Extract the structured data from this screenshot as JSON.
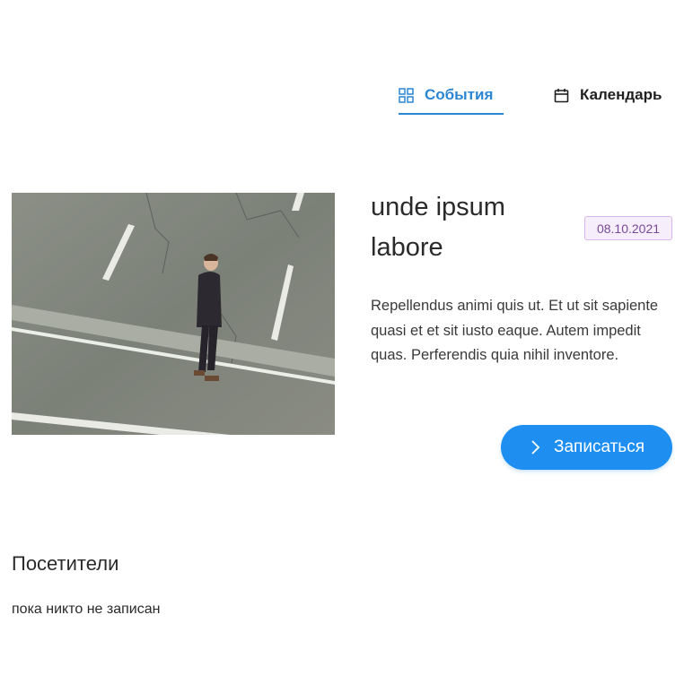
{
  "tabs": [
    {
      "label": "События",
      "icon": "grid-icon",
      "active": true
    },
    {
      "label": "Календарь",
      "icon": "calendar-icon",
      "active": false
    }
  ],
  "event": {
    "title_line1": "unde ipsum",
    "title_line2": "labore",
    "date": "08.10.2021",
    "description": "Repellendus animi quis ut. Et ut sit sapiente quasi et et sit iusto eaque. Autem impedit quas. Perferendis quia nihil inventore.",
    "signup_label": "Записаться",
    "signup_icon": "chevron-right-icon",
    "image_subject": "man-walking-on-street"
  },
  "visitors": {
    "title": "Посетители",
    "empty_text": "пока никто не записан"
  },
  "colors": {
    "accent": "#2b86d4",
    "button": "#1e8ff0",
    "badge_bg": "#f6eefb",
    "badge_border": "#d9b6ec",
    "badge_text": "#7a4a9a"
  }
}
